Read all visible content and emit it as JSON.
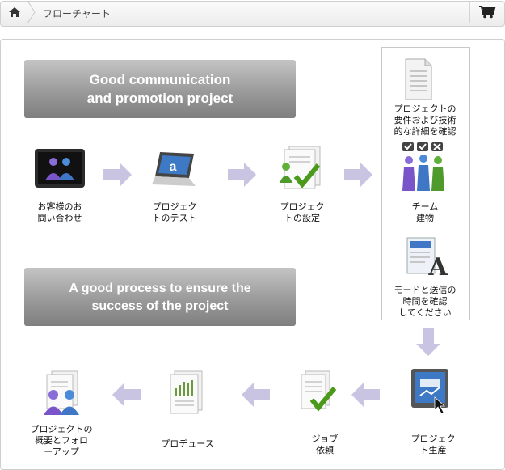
{
  "breadcrumb": {
    "label": "フローチャート"
  },
  "icons": {
    "home": "home-icon",
    "cart": "shopping-cart-icon"
  },
  "banners": {
    "top": "Good communication\nand promotion project",
    "bottom": "A good process to ensure the\nsuccess of the project"
  },
  "steps": {
    "inquiry": "お客様のお\n問い合わせ",
    "test": "プロジェク\nトのテスト",
    "setup": "プロジェク\nトの設定",
    "requirements": "プロジェクトの\n要件および技術\n的な詳細を確認",
    "team": "チーム\n建物",
    "mode": "モードと送信の\n時間を確認\nしてください",
    "production": "プロジェク\nト生産",
    "job": "ジョブ\n依頼",
    "produce": "プロデュース",
    "overview": "プロジェクトの\n概要とフォロ\nーアップ"
  },
  "colors": {
    "arrow": "#c8c4e2",
    "banner_top": "#c4c4c4",
    "banner_bottom": "#7f7f7f",
    "check": "#4c9a1c"
  }
}
